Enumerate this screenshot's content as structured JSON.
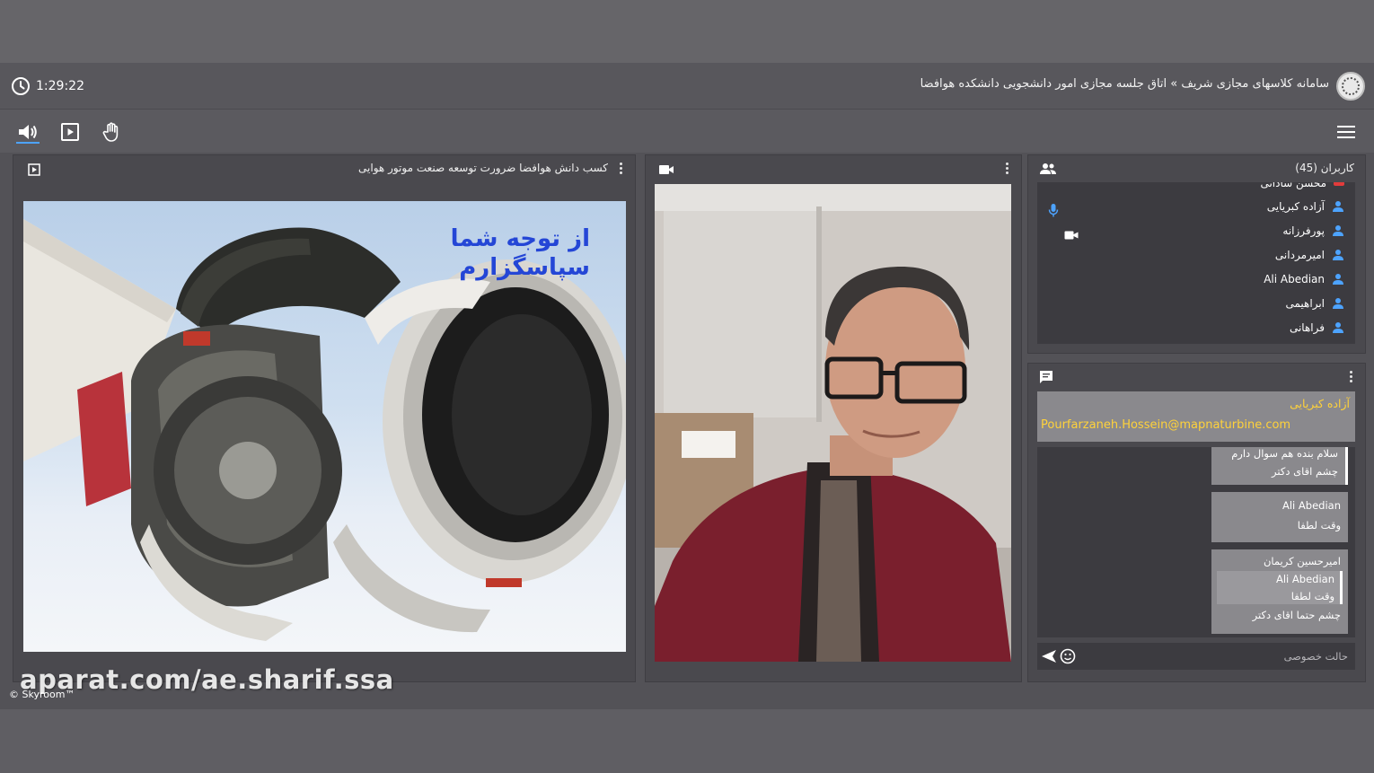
{
  "session": {
    "timer": "1:29:22",
    "breadcrumb": "سامانه کلاسهای مجازی شریف » اتاق جلسه مجازی امور دانشجویی دانشکده هوافضا"
  },
  "toolbar": {
    "icons": [
      "speaker-icon",
      "presentation-icon",
      "raise-hand-icon",
      "menu-icon"
    ]
  },
  "presentation": {
    "title": "کسب دانش هوافضا ضرورت توسعه صنعت موتور هوایی",
    "slide_text_line1": "از توجه شما",
    "slide_text_line2": "سپاسگزارم"
  },
  "users": {
    "header": "کاربران (45)",
    "items": [
      {
        "name": "محسن ساداتی",
        "status": "red"
      },
      {
        "name": "آزاده کبریایی",
        "status": "mic"
      },
      {
        "name": "پورفرزانه",
        "status": "camera"
      },
      {
        "name": "امیرمردانی",
        "status": "none"
      },
      {
        "name": "Ali Abedian",
        "status": "none"
      },
      {
        "name": "ابراهیمی",
        "status": "none"
      },
      {
        "name": "فراهانی",
        "status": "none"
      }
    ]
  },
  "chat": {
    "highlight_name": "آزاده کبریایی",
    "highlight_email": "Pourfarzaneh.Hossein@mapnaturbine.com",
    "messages": [
      {
        "lines": [
          "سلام بنده هم سوال دارم",
          "چشم اقای دکتر"
        ]
      },
      {
        "lines": [
          "Ali Abedian",
          "وقت لطفا"
        ]
      },
      {
        "lines": [
          "امیرحسین کریمان"
        ],
        "quote": [
          "Ali Abedian",
          "وقت لطفا"
        ],
        "after": [
          "چشم حتما اقای دکتر"
        ]
      }
    ],
    "input_placeholder": "حالت خصوصی"
  },
  "footer": {
    "watermark": "aparat.com/ae.sharif.ssa",
    "brand": "© Skyroom™"
  },
  "colors": {
    "accent_blue": "#4da3ff",
    "highlight_name": "#ffd23a",
    "slide_text": "#2446d6"
  }
}
